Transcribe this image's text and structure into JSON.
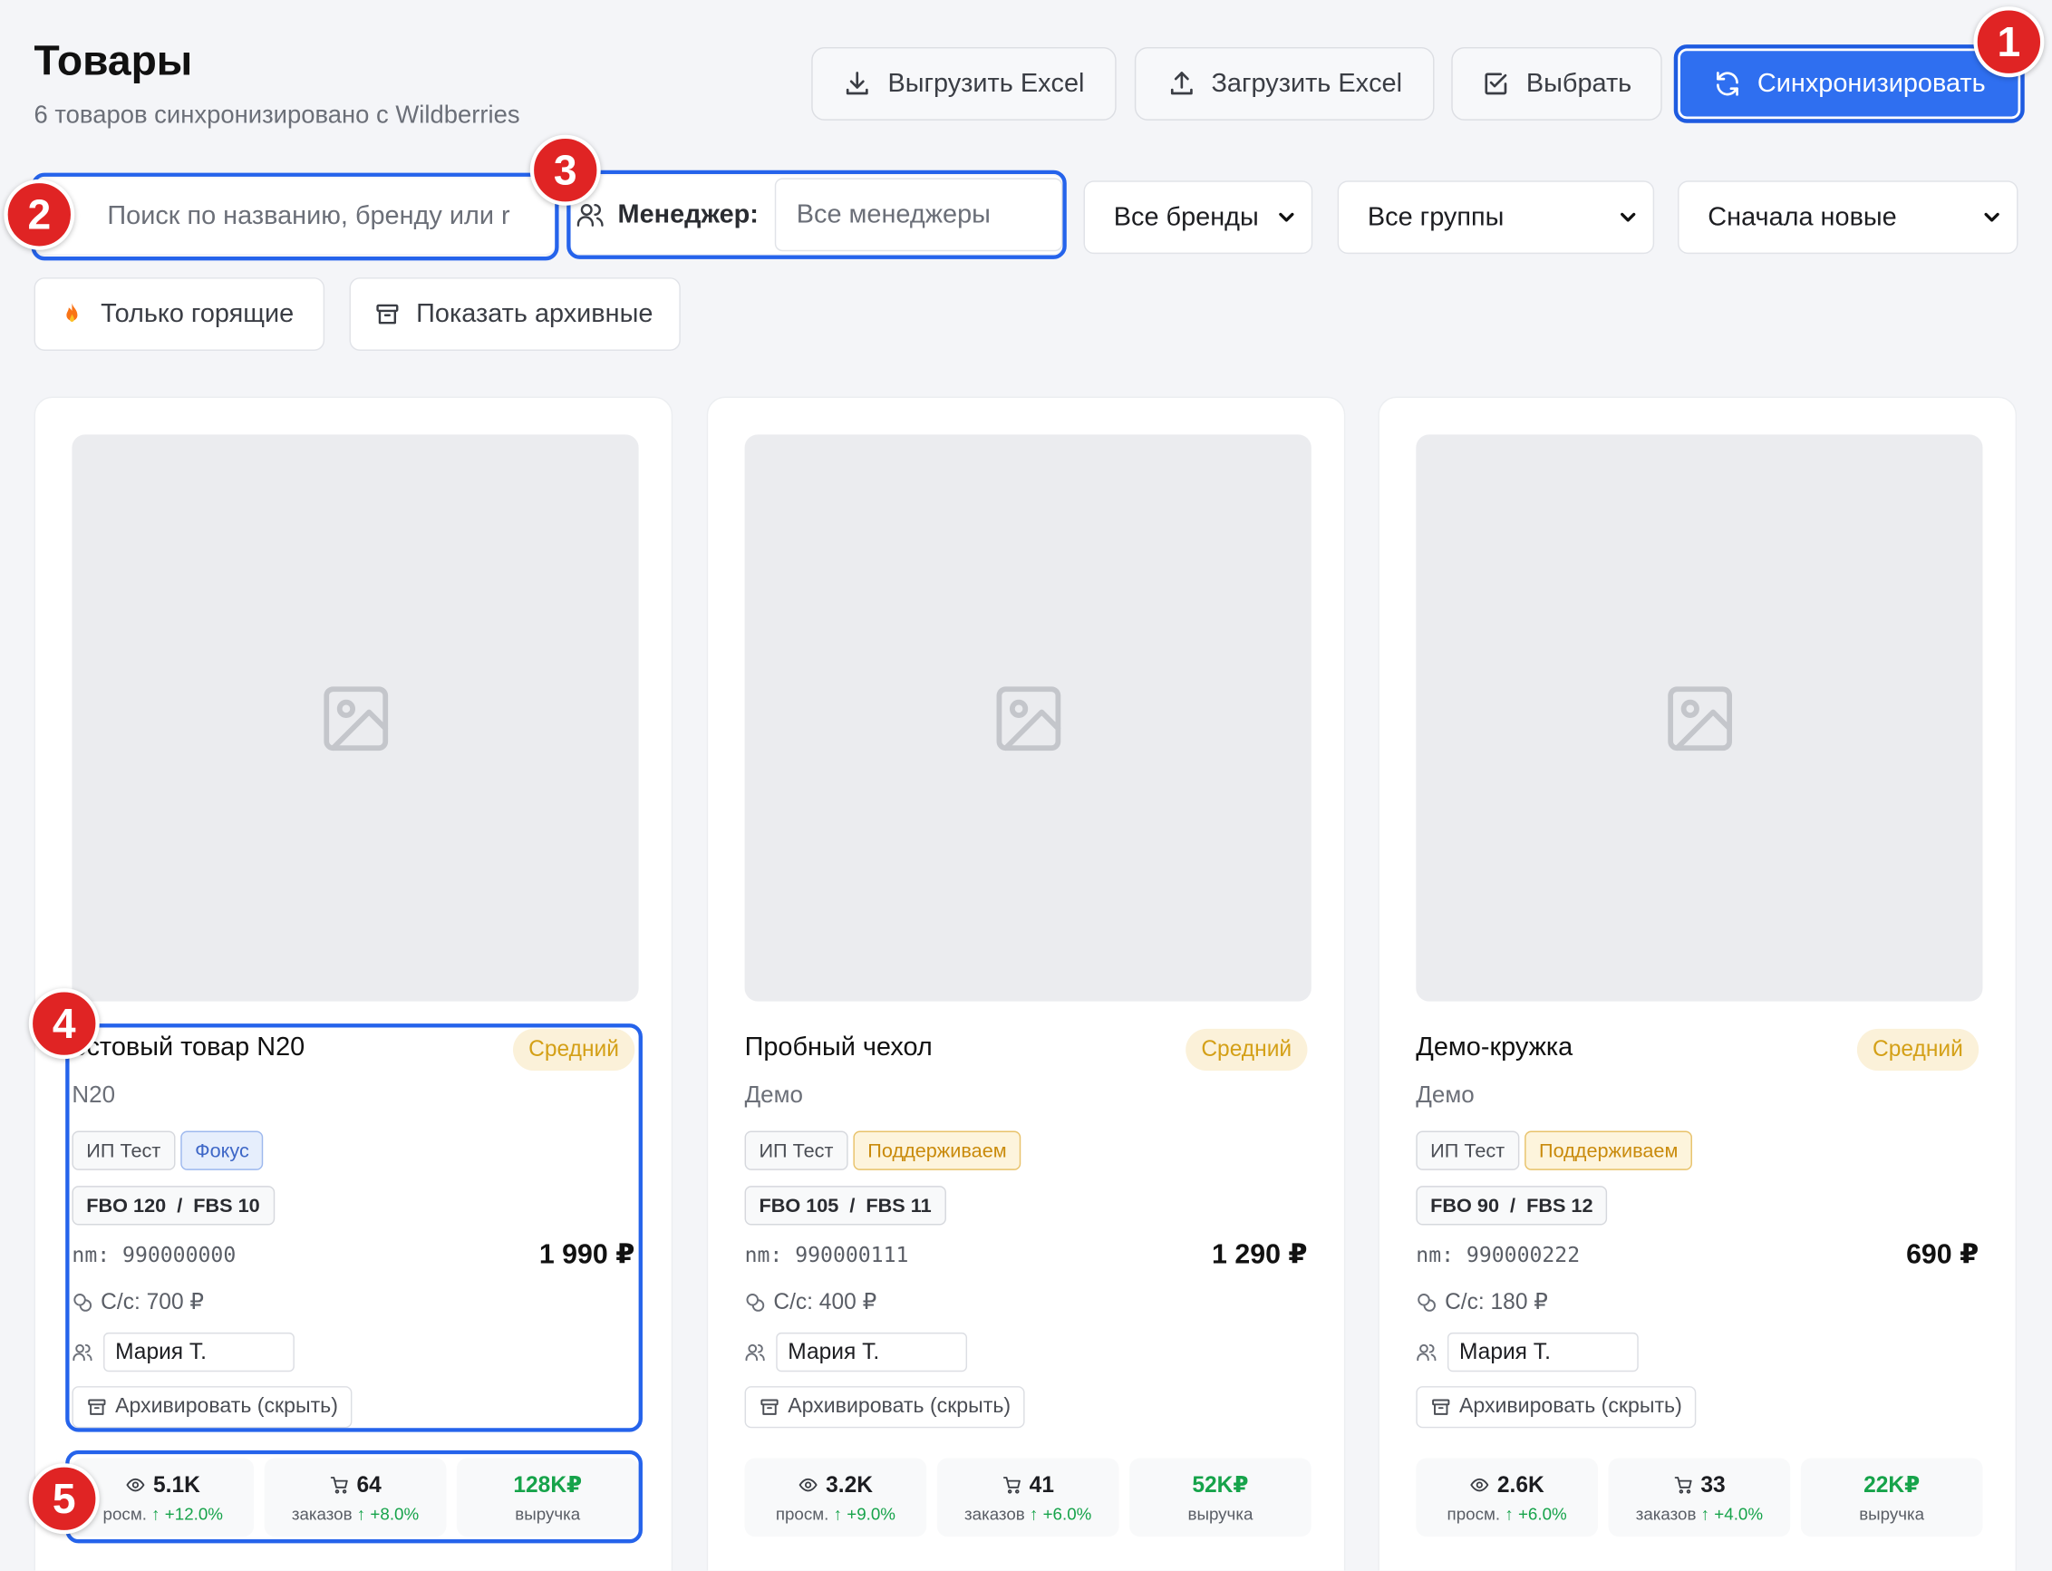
{
  "header": {
    "title": "Товары",
    "subtitle": "6 товаров синхронизировано с Wildberries"
  },
  "toolbar": {
    "export_label": "Выгрузить Excel",
    "import_label": "Загрузить Excel",
    "select_label": "Выбрать",
    "sync_label": "Синхронизировать"
  },
  "filters": {
    "search_placeholder": "Поиск по названию, бренду или r",
    "manager_label": "Менеджер:",
    "manager_placeholder": "Все менеджеры",
    "brands_value": "Все бренды",
    "groups_value": "Все группы",
    "sort_value": "Сначала новые",
    "hot_only_label": "Только горящие",
    "show_archived_label": "Показать архивные"
  },
  "markers": [
    "1",
    "2",
    "3",
    "4",
    "5"
  ],
  "products": [
    {
      "name": "ECTOBЫЙ ТОВАР N20",
      "name_display": "естовый товар N20",
      "level": "Средний",
      "brand": "N20",
      "tag_company": "ИП Тест",
      "tag_status": "Фокус",
      "stock": "FBO 120  /  FBS 10",
      "nm": "nm: 990000000",
      "price": "1 990 ₽",
      "cost": "С/с: 700 ₽",
      "manager": "Мария Т.",
      "archive_label": "Архивировать (скрыть)",
      "views": "5.1K",
      "views_label": "росм.",
      "views_delta": "+12.0%",
      "orders": "64",
      "orders_label": "заказов",
      "orders_delta": "+8.0%",
      "revenue": "128K₽",
      "revenue_label": "выручка"
    },
    {
      "name": "Пробный чехол",
      "name_display": "Пробный чехол",
      "level": "Средний",
      "brand": "Демо",
      "tag_company": "ИП Тест",
      "tag_status": "Поддерживаем",
      "stock": "FBO 105  /  FBS 11",
      "nm": "nm: 990000111",
      "price": "1 290 ₽",
      "cost": "С/с: 400 ₽",
      "manager": "Мария Т.",
      "archive_label": "Архивировать (скрыть)",
      "views": "3.2K",
      "views_label": "просм.",
      "views_delta": "+9.0%",
      "orders": "41",
      "orders_label": "заказов",
      "orders_delta": "+6.0%",
      "revenue": "52K₽",
      "revenue_label": "выручка"
    },
    {
      "name": "Демо-кружка",
      "name_display": "Демо-кружка",
      "level": "Средний",
      "brand": "Демо",
      "tag_company": "ИП Тест",
      "tag_status": "Поддерживаем",
      "stock": "FBO 90  /  FBS 12",
      "nm": "nm: 990000222",
      "price": "690 ₽",
      "cost": "С/с: 180 ₽",
      "manager": "Мария Т.",
      "archive_label": "Архивировать (скрыть)",
      "views": "2.6K",
      "views_label": "просм.",
      "views_delta": "+6.0%",
      "orders": "33",
      "orders_label": "заказов",
      "orders_delta": "+4.0%",
      "revenue": "22K₽",
      "revenue_label": "выручка"
    }
  ],
  "colors": {
    "accent": "#2f6ff0",
    "marker": "#e02424",
    "level_badge": "#d4a017",
    "positive": "#16a34a"
  },
  "icons": {
    "export": "download-icon",
    "import": "upload-icon",
    "select": "checkbox-icon",
    "sync": "refresh-icon",
    "manager": "users-icon",
    "hot": "fire-icon",
    "archive": "archive-icon",
    "placeholder": "image-icon",
    "views": "eye-icon",
    "orders": "cart-icon",
    "cost": "coins-icon"
  }
}
